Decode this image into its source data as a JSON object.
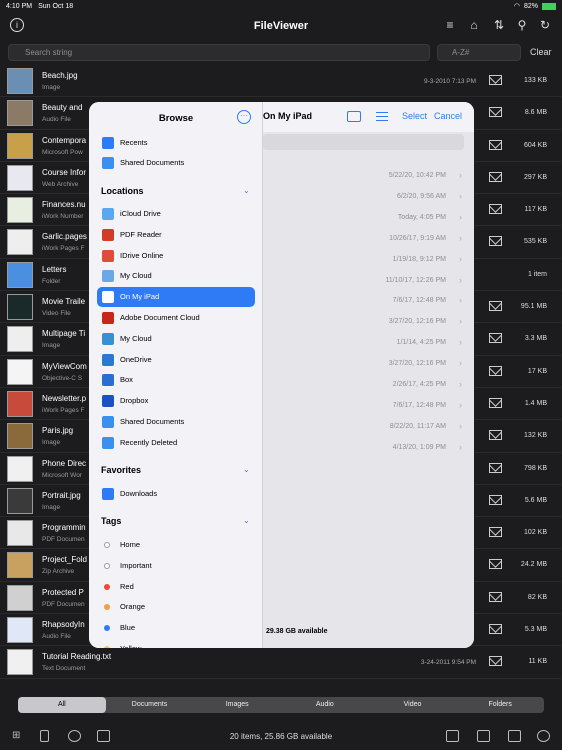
{
  "status": {
    "time": "4:10 PM",
    "date": "Sun Oct 18",
    "battery": "82%"
  },
  "app": {
    "title": "FileViewer"
  },
  "search": {
    "placeholder": "Search string",
    "filter_placeholder": "A-Z#",
    "clear_label": "Clear"
  },
  "files": [
    {
      "name": "Beach.jpg",
      "kind": "Image",
      "date": "9-3-2010 7:13 PM",
      "size": "133 KB",
      "thumb": "#6b8fb3"
    },
    {
      "name": "Beauty and",
      "kind": "Audio File",
      "date": "",
      "size": "8.6 MB",
      "thumb": "#8a7a66"
    },
    {
      "name": "Contempora",
      "kind": "Microsoft Pow",
      "date": "",
      "size": "604 KB",
      "thumb": "#c9a04a"
    },
    {
      "name": "Course Infor",
      "kind": "Web Archive",
      "date": "",
      "size": "297 KB",
      "thumb": "#e8e8f0"
    },
    {
      "name": "Finances.nu",
      "kind": "iWork Number",
      "date": "",
      "size": "117 KB",
      "thumb": "#e8efe0"
    },
    {
      "name": "Garlic.pages",
      "kind": "iWork Pages F",
      "date": "",
      "size": "535 KB",
      "thumb": "#eeeeee"
    },
    {
      "name": "Letters",
      "kind": "Folder",
      "date": "",
      "size": "1 item",
      "thumb": "#4a8fe0"
    },
    {
      "name": "Movie Traile",
      "kind": "Video File",
      "date": "",
      "size": "95.1 MB",
      "thumb": "#1a2a2a"
    },
    {
      "name": "Multipage Ti",
      "kind": "Image",
      "date": "",
      "size": "3.3 MB",
      "thumb": "#eeeeee"
    },
    {
      "name": "MyViewCom",
      "kind": "Objective-C S",
      "date": "",
      "size": "17 KB",
      "thumb": "#f4f4f4"
    },
    {
      "name": "Newsletter.p",
      "kind": "iWork Pages F",
      "date": "",
      "size": "1.4 MB",
      "thumb": "#c84a3a"
    },
    {
      "name": "Paris.jpg",
      "kind": "Image",
      "date": "",
      "size": "132 KB",
      "thumb": "#8a6a3a"
    },
    {
      "name": "Phone Direc",
      "kind": "Microsoft Wor",
      "date": "",
      "size": "798 KB",
      "thumb": "#f0f0f0"
    },
    {
      "name": "Portrait.jpg",
      "kind": "Image",
      "date": "",
      "size": "5.6 MB",
      "thumb": "#3a3a3a"
    },
    {
      "name": "Programmin",
      "kind": "PDF Documen",
      "date": "",
      "size": "102 KB",
      "thumb": "#e8e8e8"
    },
    {
      "name": "Project_Fold",
      "kind": "Zip Archive",
      "date": "",
      "size": "24.2 MB",
      "thumb": "#c8a060"
    },
    {
      "name": "Protected P",
      "kind": "PDF Documen",
      "date": "",
      "size": "82 KB",
      "thumb": "#d0d0d0"
    },
    {
      "name": "RhapsodyIn",
      "kind": "Audio File",
      "date": "",
      "size": "5.3 MB",
      "thumb": "#e0e8f8"
    },
    {
      "name": "Tutorial Reading.txt",
      "kind": "Text Document",
      "date": "3-24-2011 9:54 PM",
      "size": "11 KB",
      "thumb": "#f0f0f0"
    }
  ],
  "tabs": [
    "All",
    "Documents",
    "Images",
    "Audio",
    "Video",
    "Folders"
  ],
  "footer": {
    "info": "20 items, 25.86 GB available"
  },
  "browse": {
    "title": "Browse",
    "recents": "Recents",
    "shared_top": "Shared Documents",
    "locations_header": "Locations",
    "locations": [
      {
        "label": "iCloud Drive",
        "color": "#5aa9f0"
      },
      {
        "label": "PDF Reader",
        "color": "#d23a2a"
      },
      {
        "label": "IDrive Online",
        "color": "#e04a3a"
      },
      {
        "label": "My Cloud",
        "color": "#6aa8e8"
      },
      {
        "label": "On My iPad",
        "color": "#ffffff"
      },
      {
        "label": "Adobe Document Cloud",
        "color": "#c8261a"
      },
      {
        "label": "My Cloud",
        "color": "#3a8fd0"
      },
      {
        "label": "OneDrive",
        "color": "#2a78d0"
      },
      {
        "label": "Box",
        "color": "#2a6fd0"
      },
      {
        "label": "Dropbox",
        "color": "#1a50c8"
      },
      {
        "label": "Shared Documents",
        "color": "#3a8ff0"
      },
      {
        "label": "Recently Deleted",
        "color": "#3a8ff0"
      }
    ],
    "favorites_header": "Favorites",
    "favorites": [
      "Downloads"
    ],
    "tags_header": "Tags",
    "tags": [
      {
        "label": "Home",
        "color": "#ffffff"
      },
      {
        "label": "Important",
        "color": "#ffffff"
      },
      {
        "label": "Red",
        "color": "#e84a3a"
      },
      {
        "label": "Orange",
        "color": "#f0a040"
      },
      {
        "label": "Blue",
        "color": "#2f7bf5"
      },
      {
        "label": "Yellow",
        "color": "#f0c840"
      }
    ],
    "location_title": "On My iPad",
    "select_label": "Select",
    "cancel_label": "Cancel",
    "dates": [
      "5/22/20, 10:42 PM",
      "6/2/20, 9:56 AM",
      "Today, 4:05 PM",
      "10/26/17, 9:19 AM",
      "1/19/18, 9:12 PM",
      "11/10/17, 12:26 PM",
      "7/6/17, 12:48 PM",
      "3/27/20, 12:16 PM",
      "1/1/14, 4:25 PM",
      "3/27/20, 12:16 PM",
      "2/26/17, 4:25 PM",
      "7/6/17, 12:48 PM",
      "8/22/20, 11:17 AM",
      "4/13/20, 1:09 PM"
    ],
    "available": "29.38 GB available"
  }
}
